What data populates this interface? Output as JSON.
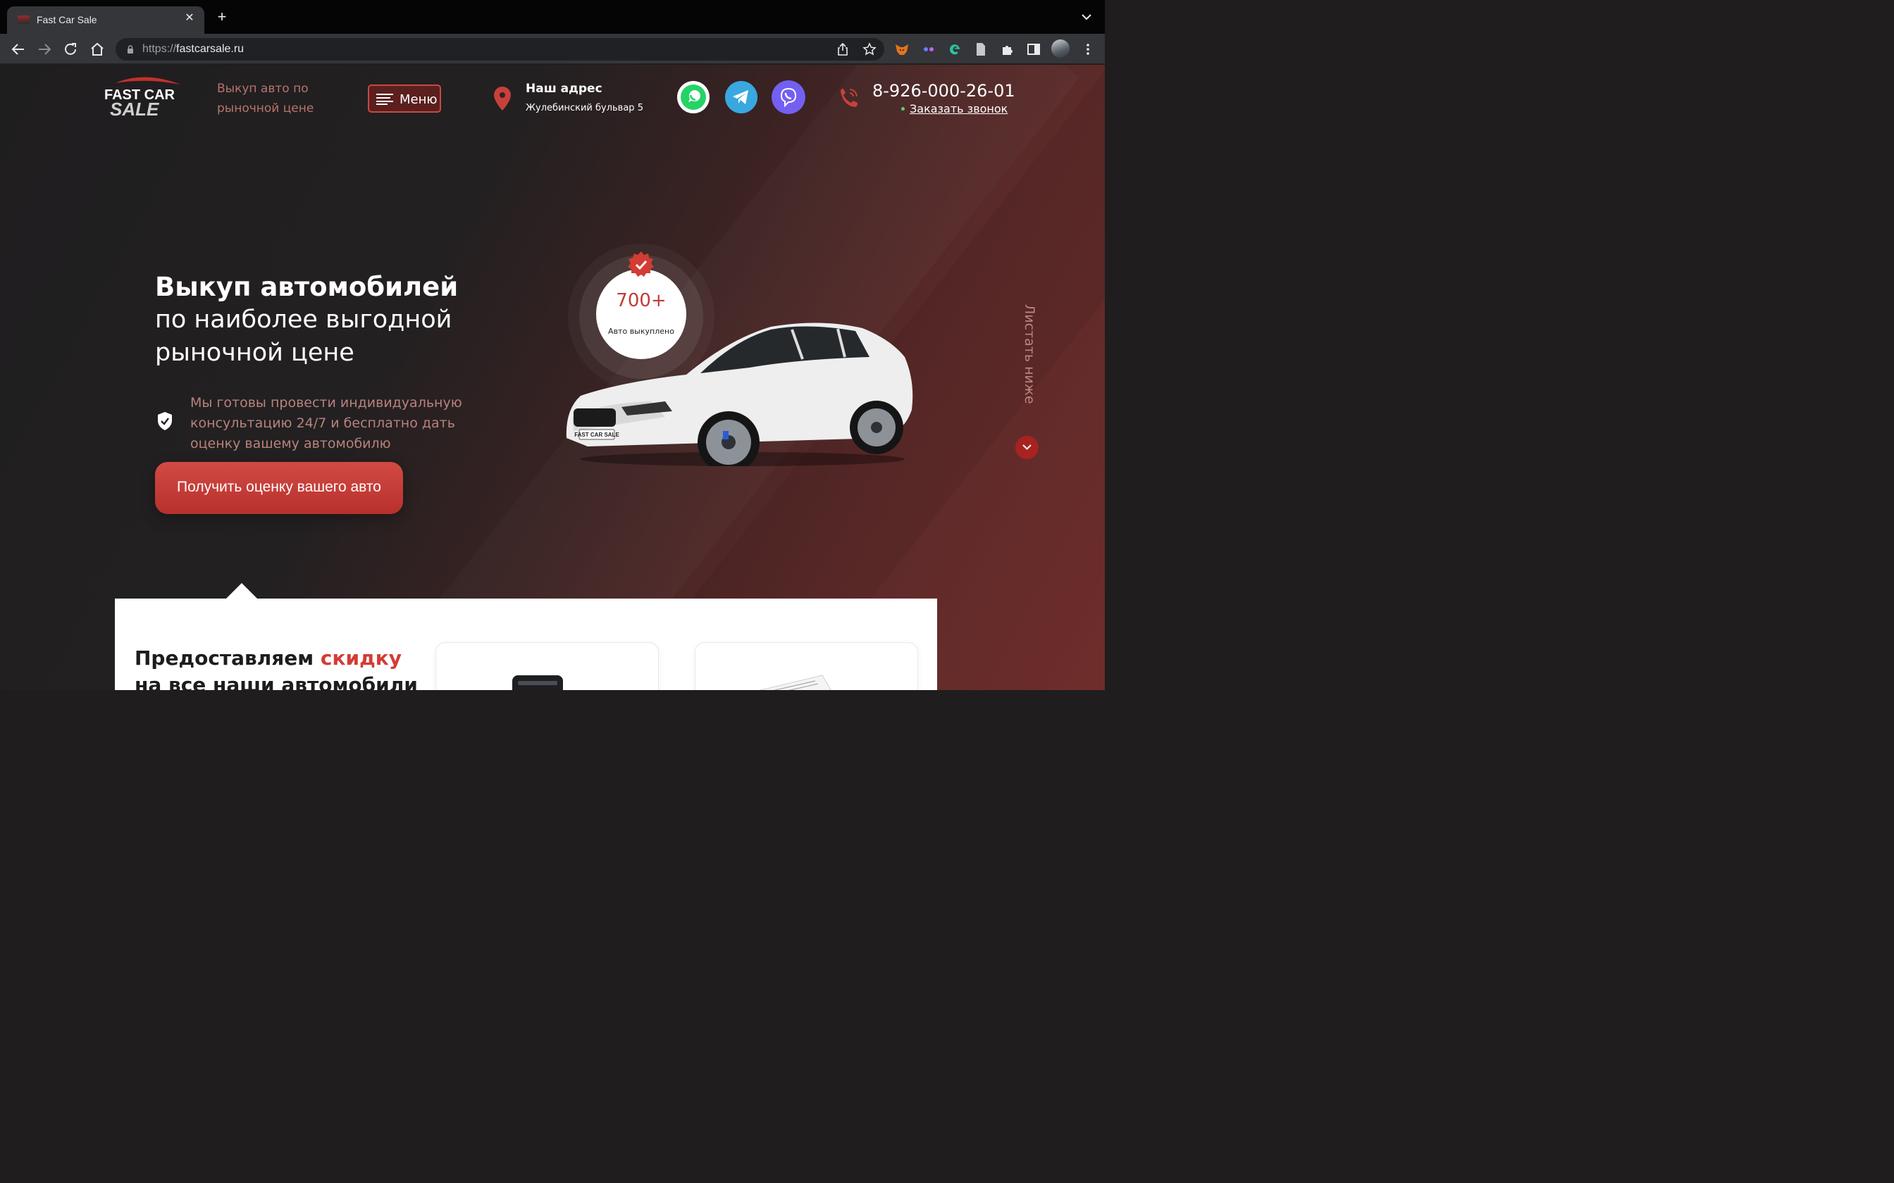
{
  "browser": {
    "tab_title": "Fast Car Sale",
    "url_scheme": "https://",
    "url_host": "fastcarsale.ru"
  },
  "header": {
    "logo_text_top": "FAST CAR",
    "logo_text_bottom": "SALE",
    "tagline": "Выкуп авто по рыночной цене",
    "menu_label": "Меню",
    "address_title": "Наш адрес",
    "address_text": "Жулебинский бульвар 5",
    "socials": [
      "whatsapp-icon",
      "telegram-icon",
      "viber-icon"
    ],
    "phone": "8-926-000-26-01",
    "callback_label": "Заказать звонок"
  },
  "hero": {
    "title_line1": "Выкуп автомобилей",
    "title_line2": "по наиболее выгодной",
    "title_line3": "рыночной цене",
    "description": "Мы готовы провести индивидуальную консультацию 24/7 и бесплатно дать оценку вашему автомобилю",
    "cta_label": "Получить оценку вашего авто",
    "badge_value": "700+",
    "badge_label": "Авто выкуплено",
    "plate_text": "FAST CAR SALE",
    "scroll_label": "Листать ниже"
  },
  "promo": {
    "title_prefix": "Предоставляем ",
    "title_accent": "скидку",
    "title_line2": "на все наши автомобили"
  },
  "colors": {
    "accent": "#d33c35",
    "dark": "#1f1e1f",
    "muted_text": "#b7827e"
  }
}
